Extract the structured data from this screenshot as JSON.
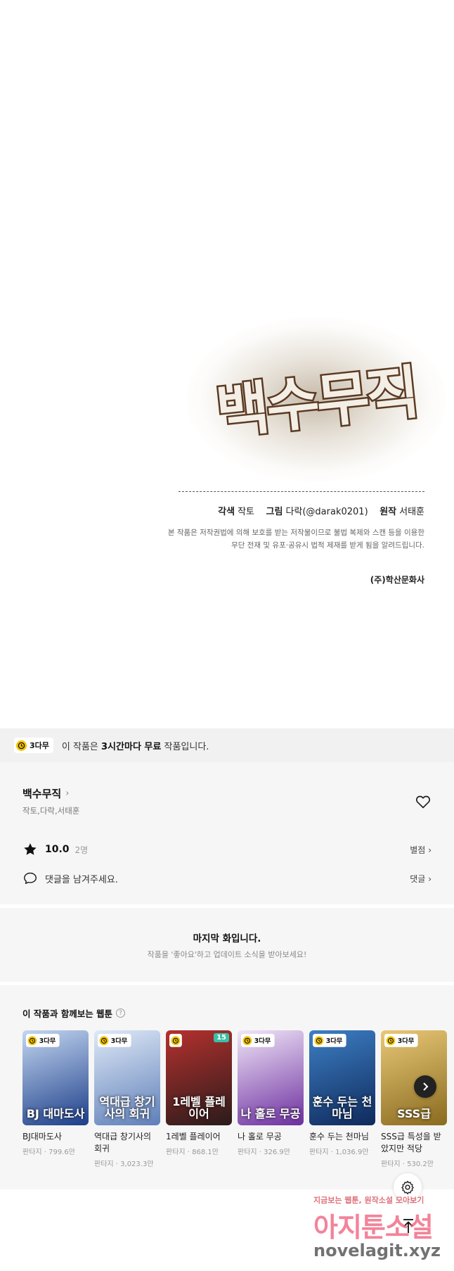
{
  "comic": {
    "logo_text": "백수무직",
    "credits": [
      {
        "label": "각색",
        "value": "작토"
      },
      {
        "label": "그림",
        "value": "다락(@darak0201)"
      },
      {
        "label": "원작",
        "value": "서태훈"
      }
    ],
    "notice_line1": "본 작품은 저작권법에 의해 보호를 받는 저작물이므로 불법 복제와 스캔 등을 이용한",
    "notice_line2": "무단 전재 및 유포·공유시 법적 제재를 받게 됨을 알려드립니다.",
    "publisher": "(주)학산문화사"
  },
  "free_banner": {
    "badge": "3다무",
    "text_prefix": "이 작품은 ",
    "text_bold": "3시간마다 무료",
    "text_suffix": " 작품입니다."
  },
  "work": {
    "title": "백수무직",
    "authors": "작토,다락,서태훈",
    "rating": "10.0",
    "rating_count": "2명",
    "rating_link": "별점",
    "comment_placeholder": "댓글을 남겨주세요.",
    "comment_link": "댓글"
  },
  "end_notice": {
    "title": "마지막 화입니다.",
    "subtitle": "작품을 '좋아요'하고 업데이트 소식을 받아보세요!"
  },
  "recommend": {
    "title": "이 작품과 함께보는 웹툰",
    "help": "?",
    "items": [
      {
        "name": "BJ대마도사",
        "genre": "판타지",
        "views": "799.6만",
        "badge": "3다무",
        "cover_text": "BJ 대마도사",
        "color1": "#1d3f8a",
        "color2": "#c3d6f0"
      },
      {
        "name": "역대급 창기사의 회귀",
        "genre": "판타지",
        "views": "3,023.3만",
        "badge": "3다무",
        "cover_text": "역대급 창기사의 회귀",
        "color1": "#5e7fb8",
        "color2": "#dfe9f7"
      },
      {
        "name": "1레벨 플레이어",
        "genre": "판타지",
        "views": "868.1만",
        "badge": "",
        "num": "15",
        "cover_text": "1레벨 플레이어",
        "color1": "#2a1b1b",
        "color2": "#b5312e"
      },
      {
        "name": "나 홀로 무공",
        "genre": "판타지",
        "views": "326.9만",
        "badge": "3다무",
        "cover_text": "나 홀로 무공",
        "color1": "#6d2fa0",
        "color2": "#f0e6f7"
      },
      {
        "name": "훈수 두는 천마님",
        "genre": "판타지",
        "views": "1,036.9만",
        "badge": "3다무",
        "cover_text": "훈수 두는 천마님",
        "color1": "#0f2a5c",
        "color2": "#3d7fc4"
      },
      {
        "name": "SSS급 특성을 받았지만 적당",
        "genre": "판타지",
        "views": "530.2만",
        "badge": "3다무",
        "cover_text": "SSS급",
        "color1": "#8a6b1f",
        "color2": "#e8c877"
      }
    ]
  },
  "watermark": {
    "small": "지금보는 웹툰, 원작소설 모아보기",
    "big": "아지툰소설",
    "url": "novelagit.xyz"
  },
  "colors": {
    "accent_yellow": "#f5c400",
    "background_gray": "#f6f6f6"
  }
}
